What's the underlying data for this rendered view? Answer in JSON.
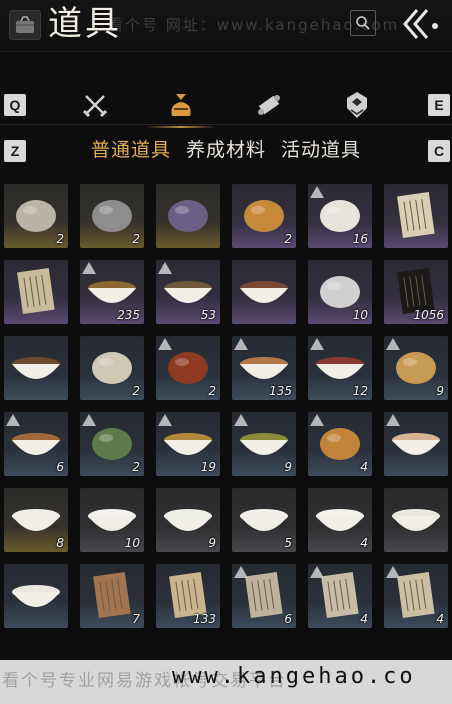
{
  "header": {
    "title": "道具",
    "watermark": "看个号  网址：www.kangehao.com"
  },
  "category_bar": {
    "key_left_top": "Q",
    "key_right_top": "E",
    "key_left_bottom": "Z",
    "key_right_bottom": "C",
    "tabs": [
      {
        "icon": "crossed-swords-icon"
      },
      {
        "icon": "bag-icon",
        "active": true
      },
      {
        "icon": "scroll-icon"
      },
      {
        "icon": "gem-icon"
      }
    ]
  },
  "sub_tabs": [
    {
      "label": "普通道具",
      "active": true
    },
    {
      "label": "养成材料"
    },
    {
      "label": "活动道具"
    }
  ],
  "items": [
    {
      "name": "silver-ore",
      "count": "2",
      "rarity": "gold"
    },
    {
      "name": "dark-ore",
      "count": "2",
      "rarity": "gold"
    },
    {
      "name": "dragonfly",
      "count": "",
      "rarity": "gold"
    },
    {
      "name": "golden-orb-stand",
      "count": "2",
      "rarity": "purple"
    },
    {
      "name": "steamed-buns",
      "count": "16",
      "rarity": "purple",
      "tag": "leaf"
    },
    {
      "name": "letter",
      "count": "",
      "rarity": "purple"
    },
    {
      "name": "document",
      "count": "",
      "rarity": "purple"
    },
    {
      "name": "fried-dish",
      "count": "235",
      "rarity": "purple",
      "tag": "drop"
    },
    {
      "name": "soup-pot",
      "count": "53",
      "rarity": "purple",
      "tag": "drop"
    },
    {
      "name": "meat-bowl",
      "count": "",
      "rarity": "purple"
    },
    {
      "name": "mountain-token",
      "count": "10",
      "rarity": "purple"
    },
    {
      "name": "gold-scroll",
      "count": "1056",
      "rarity": "purple"
    },
    {
      "name": "dumplings-plate",
      "count": "",
      "rarity": "blue"
    },
    {
      "name": "rice-cakes",
      "count": "2",
      "rarity": "blue"
    },
    {
      "name": "roast-leg",
      "count": "2",
      "rarity": "blue",
      "tag": "up"
    },
    {
      "name": "bun-plate",
      "count": "135",
      "rarity": "blue",
      "tag": "up"
    },
    {
      "name": "sausage-plate",
      "count": "12",
      "rarity": "blue",
      "tag": "up"
    },
    {
      "name": "pastry-box",
      "count": "9",
      "rarity": "blue",
      "tag": "up"
    },
    {
      "name": "fish-plate",
      "count": "6",
      "rarity": "blue",
      "tag": "up"
    },
    {
      "name": "gourd",
      "count": "2",
      "rarity": "blue",
      "tag": "up"
    },
    {
      "name": "noodle-bowl",
      "count": "19",
      "rarity": "blue",
      "tag": "up"
    },
    {
      "name": "greens-bowl",
      "count": "9",
      "rarity": "blue",
      "tag": "up"
    },
    {
      "name": "flatbread-stack",
      "count": "4",
      "rarity": "blue",
      "tag": "up"
    },
    {
      "name": "shrimp-dish",
      "count": "",
      "rarity": "blue",
      "tag": "up"
    },
    {
      "name": "porcelain-bowl-red",
      "count": "8",
      "rarity": "gold"
    },
    {
      "name": "porcelain-bowl",
      "count": "10",
      "rarity": "gray"
    },
    {
      "name": "porcelain-bowl-bird",
      "count": "9",
      "rarity": "gray"
    },
    {
      "name": "porcelain-bowl-rooster",
      "count": "5",
      "rarity": "gray"
    },
    {
      "name": "porcelain-bowl-ink",
      "count": "4",
      "rarity": "gray"
    },
    {
      "name": "porcelain-cup",
      "count": "",
      "rarity": "gray"
    },
    {
      "name": "porcelain-dish",
      "count": "",
      "rarity": "blue"
    },
    {
      "name": "bamboo-book",
      "count": "7",
      "rarity": "blue"
    },
    {
      "name": "paper-sheets",
      "count": "133",
      "rarity": "blue"
    },
    {
      "name": "note-paper-1",
      "count": "6",
      "rarity": "blue",
      "tag": "doc"
    },
    {
      "name": "note-paper-2",
      "count": "4",
      "rarity": "blue",
      "tag": "doc"
    },
    {
      "name": "note-paper-3",
      "count": "4",
      "rarity": "blue",
      "tag": "doc"
    }
  ],
  "bottom": {
    "left_text": "看个号专业网易游戏帐号交易平台",
    "url": "www.kangehao.co"
  },
  "colors": {
    "accent": "#e2ad52",
    "background": "#0d0d0e"
  }
}
